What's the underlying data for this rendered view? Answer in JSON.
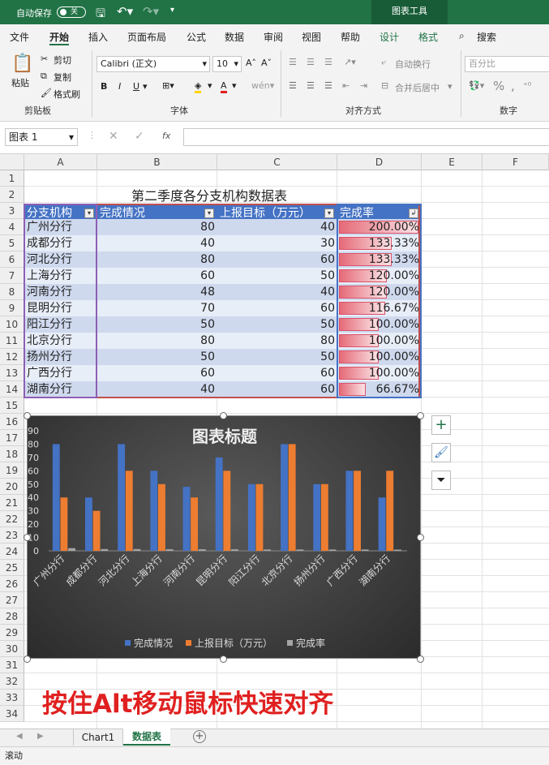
{
  "titlebar": {
    "autosave_label": "自动保存",
    "autosave_state": "关",
    "context_tab": "图表工具"
  },
  "menu": [
    "文件",
    "开始",
    "插入",
    "页面布局",
    "公式",
    "数据",
    "审阅",
    "视图",
    "帮助",
    "设计",
    "格式"
  ],
  "menu_search": "搜索",
  "ribbon": {
    "paste": "粘贴",
    "cut": "剪切",
    "copy": "复制",
    "format_painter": "格式刷",
    "group_clipboard": "剪贴板",
    "font_name": "Calibri (正文)",
    "font_size": "10",
    "group_font": "字体",
    "wrap_text": "自动换行",
    "merge_center": "合并后居中",
    "group_align": "对齐方式",
    "number_format": "百分比",
    "group_number": "数字"
  },
  "formula_bar": {
    "name_box": "图表 1",
    "formula": ""
  },
  "columns": [
    "A",
    "B",
    "C",
    "D",
    "E",
    "F"
  ],
  "rows": [
    "1",
    "2",
    "3",
    "4",
    "5",
    "6",
    "7",
    "8",
    "9",
    "10",
    "11",
    "12",
    "13",
    "14",
    "15",
    "16",
    "17",
    "18",
    "19",
    "20",
    "21",
    "22",
    "23",
    "24",
    "25",
    "26",
    "27",
    "28",
    "29",
    "30",
    "31",
    "32",
    "33",
    "34"
  ],
  "sheet": {
    "title": "第二季度各分支机构数据表",
    "headers": [
      "分支机构",
      "完成情况",
      "上报目标（万元）",
      "完成率"
    ],
    "rows": [
      {
        "name": "广州分行",
        "done": "80",
        "target": "40",
        "rate": "200.00%",
        "rate_value": 2.0
      },
      {
        "name": "成都分行",
        "done": "40",
        "target": "30",
        "rate": "133.33%",
        "rate_value": 1.3333
      },
      {
        "name": "河北分行",
        "done": "80",
        "target": "60",
        "rate": "133.33%",
        "rate_value": 1.3333
      },
      {
        "name": "上海分行",
        "done": "60",
        "target": "50",
        "rate": "120.00%",
        "rate_value": 1.2
      },
      {
        "name": "河南分行",
        "done": "48",
        "target": "40",
        "rate": "120.00%",
        "rate_value": 1.2
      },
      {
        "name": "昆明分行",
        "done": "70",
        "target": "60",
        "rate": "116.67%",
        "rate_value": 1.1667
      },
      {
        "name": "阳江分行",
        "done": "50",
        "target": "50",
        "rate": "100.00%",
        "rate_value": 1.0
      },
      {
        "name": "北京分行",
        "done": "80",
        "target": "80",
        "rate": "100.00%",
        "rate_value": 1.0
      },
      {
        "name": "扬州分行",
        "done": "50",
        "target": "50",
        "rate": "100.00%",
        "rate_value": 1.0
      },
      {
        "name": "广西分行",
        "done": "60",
        "target": "60",
        "rate": "100.00%",
        "rate_value": 1.0
      },
      {
        "name": "湖南分行",
        "done": "40",
        "target": "60",
        "rate": "66.67%",
        "rate_value": 0.6667
      }
    ]
  },
  "chart_data": {
    "type": "bar",
    "title": "图表标题",
    "categories": [
      "广州分行",
      "成都分行",
      "河北分行",
      "上海分行",
      "河南分行",
      "昆明分行",
      "阳江分行",
      "北京分行",
      "扬州分行",
      "广西分行",
      "湖南分行"
    ],
    "series": [
      {
        "name": "完成情况",
        "color": "#4472c4",
        "values": [
          80,
          40,
          80,
          60,
          48,
          70,
          50,
          80,
          50,
          60,
          40
        ]
      },
      {
        "name": "上报目标（万元）",
        "color": "#ed7d31",
        "values": [
          40,
          30,
          60,
          50,
          40,
          60,
          50,
          80,
          50,
          60,
          60
        ]
      },
      {
        "name": "完成率",
        "color": "#a5a5a5",
        "values": [
          2.0,
          1.3333,
          1.3333,
          1.2,
          1.2,
          1.1667,
          1.0,
          1.0,
          1.0,
          1.0,
          0.6667
        ]
      }
    ],
    "yticks": [
      "0",
      "10",
      "20",
      "30",
      "40",
      "50",
      "60",
      "70",
      "80",
      "90"
    ],
    "ylim": [
      0,
      90
    ],
    "legend": "bottom",
    "grid": false
  },
  "overlay_caption": "按住Alt移动鼠标快速对齐",
  "tabs": [
    "Chart1",
    "数据表"
  ],
  "active_tab": "数据表",
  "status_text": "滚动",
  "colors": {
    "excel_green": "#217346",
    "table_header": "#4472c4",
    "caption_red": "#e02020"
  }
}
